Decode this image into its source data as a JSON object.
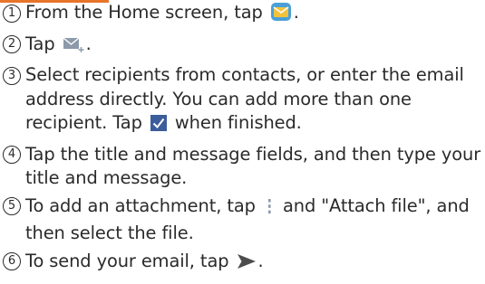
{
  "steps": [
    {
      "num": "1",
      "parts": [
        {
          "type": "text",
          "text": "From the Home screen, tap "
        },
        {
          "type": "icon",
          "icon": "email-app-icon"
        },
        {
          "type": "text",
          "text": "."
        }
      ]
    },
    {
      "num": "2",
      "parts": [
        {
          "type": "text",
          "text": "Tap "
        },
        {
          "type": "icon",
          "icon": "compose-email-icon"
        },
        {
          "type": "text",
          "text": "."
        }
      ]
    },
    {
      "num": "3",
      "parts": [
        {
          "type": "text",
          "text": "Select recipients from contacts, or enter the email address directly. You can add more than one recipient. Tap "
        },
        {
          "type": "icon",
          "icon": "checkmark-icon"
        },
        {
          "type": "text",
          "text": " when finished."
        }
      ]
    },
    {
      "num": "4",
      "parts": [
        {
          "type": "text",
          "text": "Tap the title and message fields, and then type your title and message."
        }
      ]
    },
    {
      "num": "5",
      "parts": [
        {
          "type": "text",
          "text": "To add an attachment, tap "
        },
        {
          "type": "icon",
          "icon": "more-options-icon"
        },
        {
          "type": "text",
          "text": " and \"Attach file\", and then select the file."
        }
      ]
    },
    {
      "num": "6",
      "parts": [
        {
          "type": "text",
          "text": "To send your email, tap "
        },
        {
          "type": "icon",
          "icon": "send-icon"
        },
        {
          "type": "text",
          "text": "."
        }
      ]
    }
  ],
  "colors": {
    "text": "#2a2a2a",
    "accent": "#e8742a",
    "check": "#3b5d9c",
    "compose": "#8c9aaa",
    "send": "#4d4d4d"
  }
}
